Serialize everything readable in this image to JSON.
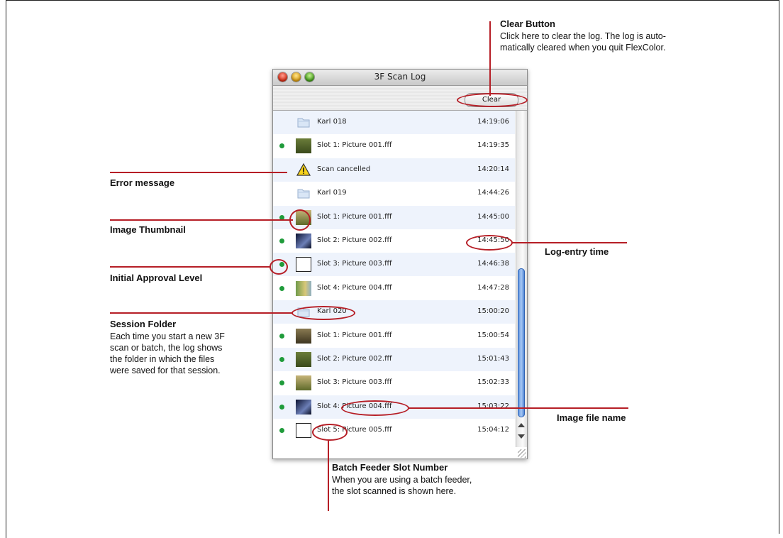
{
  "window": {
    "title": "3F Scan Log",
    "clear_label": "Clear"
  },
  "rows": [
    {
      "name": "Karl 018",
      "time": "14:19:06",
      "thumb": "folder-icon",
      "approved": false,
      "alt": true
    },
    {
      "name": "Slot 1: Picture 001.fff",
      "time": "14:19:35",
      "thumb": "image-thumbnail",
      "approved": true,
      "alt": false
    },
    {
      "name": "Scan cancelled",
      "time": "14:20:14",
      "thumb": "warning-icon",
      "approved": false,
      "alt": true
    },
    {
      "name": "Karl 019",
      "time": "14:44:26",
      "thumb": "folder-icon",
      "approved": false,
      "alt": false
    },
    {
      "name": "Slot 1: Picture 001.fff",
      "time": "14:45:00",
      "thumb": "image-thumbnail",
      "approved": true,
      "alt": true
    },
    {
      "name": "Slot 2: Picture 002.fff",
      "time": "14:45:50",
      "thumb": "image-thumbnail",
      "approved": true,
      "alt": false
    },
    {
      "name": "Slot 3: Picture 003.fff",
      "time": "14:46:38",
      "thumb": "image-thumbnail",
      "approved": true,
      "alt": true
    },
    {
      "name": "Slot 4: Picture 004.fff",
      "time": "14:47:28",
      "thumb": "image-thumbnail",
      "approved": true,
      "alt": false
    },
    {
      "name": "Karl 020",
      "time": "15:00:20",
      "thumb": "folder-icon",
      "approved": false,
      "alt": true
    },
    {
      "name": "Slot 1: Picture 001.fff",
      "time": "15:00:54",
      "thumb": "image-thumbnail",
      "approved": true,
      "alt": false
    },
    {
      "name": "Slot 2: Picture 002.fff",
      "time": "15:01:43",
      "thumb": "image-thumbnail",
      "approved": true,
      "alt": true
    },
    {
      "name": "Slot 3: Picture 003.fff",
      "time": "15:02:33",
      "thumb": "image-thumbnail",
      "approved": true,
      "alt": false
    },
    {
      "name": "Slot 4: Picture 004.fff",
      "time": "15:03:22",
      "thumb": "image-thumbnail",
      "approved": true,
      "alt": true
    },
    {
      "name": "Slot 5: Picture 005.fff",
      "time": "15:04:12",
      "thumb": "image-thumbnail",
      "approved": true,
      "alt": false
    }
  ],
  "annotations": {
    "clear_button": {
      "title": "Clear Button",
      "text": "Click here to clear the log. The log is auto-matically cleared when you quit FlexColor.",
      "line1": "Click here to clear the log. The log is auto-",
      "line2": "matically cleared when you quit FlexColor."
    },
    "error_message": {
      "title": "Error message"
    },
    "image_thumbnail": {
      "title": "Image Thumbnail"
    },
    "approval_level": {
      "title": "Initial Approval Level"
    },
    "session_folder": {
      "title": "Session Folder",
      "line1": "Each time you start a new 3F",
      "line2": "scan or batch, the log shows",
      "line3": "the folder in which the files",
      "line4": "were saved for that session."
    },
    "log_entry_time": {
      "title": "Log-entry time"
    },
    "image_file_name": {
      "title": "Image file name"
    },
    "slot_number": {
      "title": "Batch Feeder Slot Number",
      "line1": "When you are using a batch feeder,",
      "line2": "the slot scanned is shown here."
    }
  },
  "colors": {
    "annotation": "#b61e26",
    "approval_dot": "#1f9b3a",
    "row_alt": "#eef3fc"
  }
}
